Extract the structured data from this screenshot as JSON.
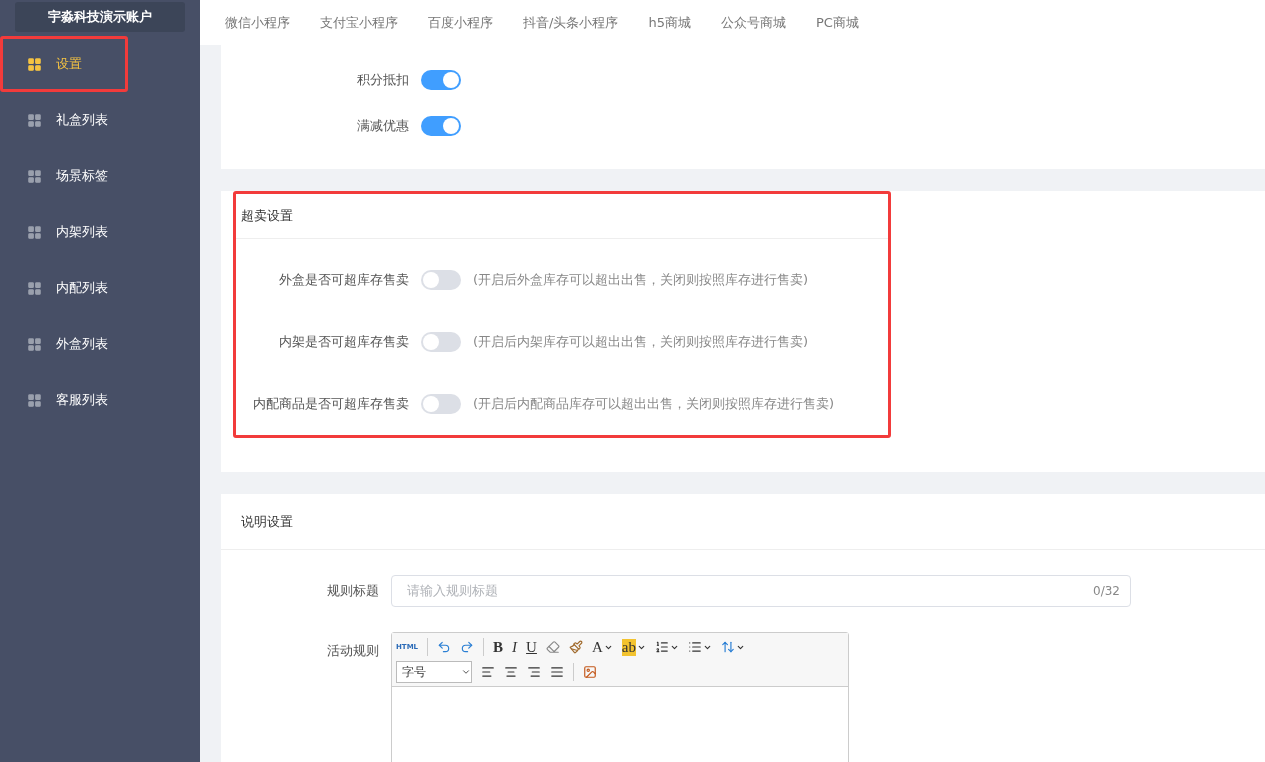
{
  "sidebar": {
    "account": "宇淼科技演示账户",
    "items": [
      {
        "label": "设置",
        "selected": true,
        "highlighted": true
      },
      {
        "label": "礼盒列表",
        "selected": false,
        "highlighted": false
      },
      {
        "label": "场景标签",
        "selected": false,
        "highlighted": false
      },
      {
        "label": "内架列表",
        "selected": false,
        "highlighted": false
      },
      {
        "label": "内配列表",
        "selected": false,
        "highlighted": false
      },
      {
        "label": "外盒列表",
        "selected": false,
        "highlighted": false
      },
      {
        "label": "客服列表",
        "selected": false,
        "highlighted": false
      }
    ]
  },
  "tabs": [
    {
      "label": "微信小程序",
      "selected": false
    },
    {
      "label": "支付宝小程序",
      "selected": false
    },
    {
      "label": "百度小程序",
      "selected": false
    },
    {
      "label": "抖音/头条小程序",
      "selected": false
    },
    {
      "label": "h5商城",
      "selected": false
    },
    {
      "label": "公众号商城",
      "selected": false
    },
    {
      "label": "PC商城",
      "selected": false
    }
  ],
  "discount_card": {
    "rows": [
      {
        "label": "积分抵扣",
        "on": true
      },
      {
        "label": "满减优惠",
        "on": true
      }
    ]
  },
  "oversell_card": {
    "title": "超卖设置",
    "highlighted": true,
    "rows": [
      {
        "label": "外盒是否可超库存售卖",
        "on": false,
        "hint": "(开启后外盒库存可以超出出售，关闭则按照库存进行售卖)"
      },
      {
        "label": "内架是否可超库存售卖",
        "on": false,
        "hint": "(开启后内架库存可以超出出售，关闭则按照库存进行售卖)"
      },
      {
        "label": "内配商品是否可超库存售卖",
        "on": false,
        "hint": "(开启后内配商品库存可以超出出售，关闭则按照库存进行售卖)"
      }
    ]
  },
  "description_card": {
    "title": "说明设置",
    "rule_title": {
      "label": "规则标题",
      "placeholder": "请输入规则标题",
      "counter": "0/32"
    },
    "activity_rules": {
      "label": "活动规则",
      "toolbar_row_1": [
        {
          "kind": "text",
          "label": "HTML",
          "menu": false
        },
        {
          "kind": "sep"
        },
        {
          "kind": "undo",
          "menu": false
        },
        {
          "kind": "redo",
          "menu": false
        },
        {
          "kind": "sep"
        },
        {
          "kind": "bold",
          "label": "B",
          "menu": false
        },
        {
          "kind": "italic",
          "label": "I",
          "menu": false
        },
        {
          "kind": "underline",
          "label": "U",
          "menu": false
        },
        {
          "kind": "eraser",
          "menu": false
        },
        {
          "kind": "brush",
          "menu": false
        },
        {
          "kind": "serif",
          "label": "A",
          "menu": true
        },
        {
          "kind": "highlight",
          "label": "ab",
          "menu": true
        },
        {
          "kind": "ordered",
          "menu": true
        },
        {
          "kind": "bullets",
          "menu": true
        },
        {
          "kind": "spacing",
          "menu": true
        }
      ],
      "font_size": "字号",
      "toolbar_row_2": [
        {
          "kind": "left",
          "menu": false
        },
        {
          "kind": "center",
          "menu": false
        },
        {
          "kind": "right",
          "menu": false
        },
        {
          "kind": "justify",
          "menu": false
        },
        {
          "kind": "sep"
        },
        {
          "kind": "image",
          "menu": false
        }
      ]
    }
  }
}
